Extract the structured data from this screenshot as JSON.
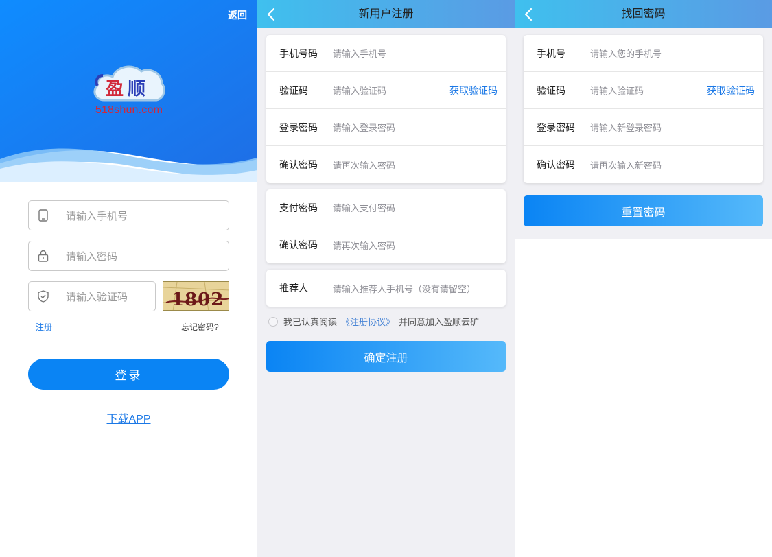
{
  "login": {
    "back": "返回",
    "logo_text": "518shun.com",
    "logo_chars": [
      "盈",
      "顺"
    ],
    "phone_placeholder": "请输入手机号",
    "password_placeholder": "请输入密码",
    "captcha_placeholder": "请输入验证码",
    "captcha_code": "1802",
    "register_link": "注册",
    "forgot_link": "忘记密码?",
    "login_button": "登录",
    "download_link": "下载APP"
  },
  "register": {
    "title": "新用户注册",
    "rows_group1": [
      {
        "label": "手机号码",
        "placeholder": "请输入手机号"
      },
      {
        "label": "验证码",
        "placeholder": "请输入验证码",
        "link": "获取验证码"
      },
      {
        "label": "登录密码",
        "placeholder": "请输入登录密码"
      },
      {
        "label": "确认密码",
        "placeholder": "请再次输入密码"
      }
    ],
    "rows_group2": [
      {
        "label": "支付密码",
        "placeholder": "请输入支付密码"
      },
      {
        "label": "确认密码",
        "placeholder": "请再次输入密码"
      }
    ],
    "rows_group3": [
      {
        "label": "推荐人",
        "placeholder": "请输入推荐人手机号（没有请留空）"
      }
    ],
    "agree_prefix": "我已认真阅读",
    "agree_link": "《注册协议》",
    "agree_suffix": "并同意加入盈顺云矿",
    "submit": "确定注册"
  },
  "reset": {
    "title": "找回密码",
    "rows": [
      {
        "label": "手机号",
        "placeholder": "请输入您的手机号"
      },
      {
        "label": "验证码",
        "placeholder": "请输入验证码",
        "link": "获取验证码"
      },
      {
        "label": "登录密码",
        "placeholder": "请输入新登录密码"
      },
      {
        "label": "确认密码",
        "placeholder": "请再次输入新密码"
      }
    ],
    "submit": "重置密码"
  },
  "colors": {
    "primary": "#0a84f4",
    "link": "#1b78e6",
    "header_start": "#3fc0ee",
    "header_end": "#5a9be4",
    "logo_red": "#d1293a",
    "logo_blue": "#2b3fb8"
  }
}
